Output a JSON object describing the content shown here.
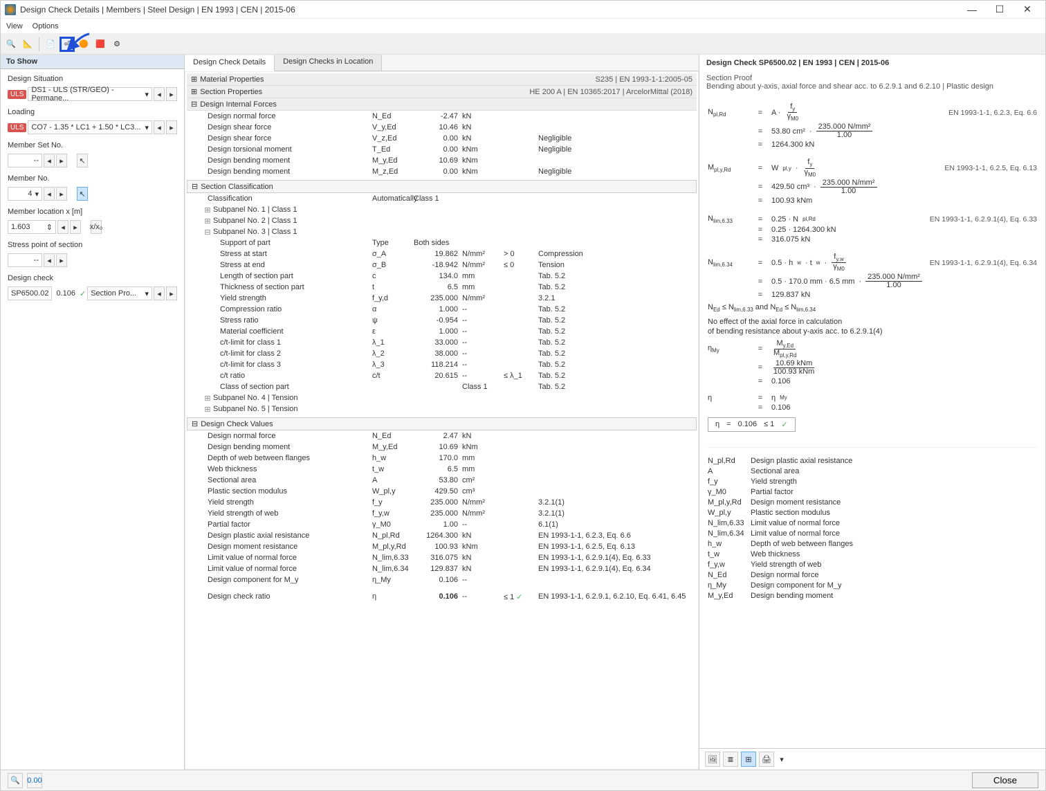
{
  "window": {
    "title": "Design Check Details | Members | Steel Design | EN 1993 | CEN | 2015-06"
  },
  "menu": {
    "view": "View",
    "options": "Options"
  },
  "left": {
    "header": "To Show",
    "ds_label": "Design Situation",
    "ds_value": "DS1 - ULS (STR/GEO) - Permane...",
    "load_label": "Loading",
    "load_value": "CO7 - 1.35 * LC1 + 1.50 * LC3...",
    "memset_label": "Member Set No.",
    "memset_value": "--",
    "memno_label": "Member No.",
    "memno_value": "4",
    "loc_label": "Member location x [m]",
    "loc_value": "1.603",
    "stress_label": "Stress point of section",
    "stress_value": "--",
    "dc_label": "Design check",
    "dc_code": "SP6500.02",
    "dc_ratio": "0.106",
    "dc_name": "Section Pro..."
  },
  "tabs": {
    "t1": "Design Check Details",
    "t2": "Design Checks in Location"
  },
  "mat_props": {
    "label": "Material Properties",
    "right": "S235 | EN 1993-1-1:2005-05"
  },
  "sec_props": {
    "label": "Section Properties",
    "right": "HE 200 A | EN 10365:2017 | ArcelorMittal (2018)"
  },
  "dif": {
    "label": "Design Internal Forces",
    "rows": [
      {
        "lbl": "Design normal force",
        "sym": "N_Ed",
        "val": "-2.47",
        "unit": "kN",
        "ref": ""
      },
      {
        "lbl": "Design shear force",
        "sym": "V_y,Ed",
        "val": "10.46",
        "unit": "kN",
        "ref": ""
      },
      {
        "lbl": "Design shear force",
        "sym": "V_z,Ed",
        "val": "0.00",
        "unit": "kN",
        "ref": "Negligible"
      },
      {
        "lbl": "Design torsional moment",
        "sym": "T_Ed",
        "val": "0.00",
        "unit": "kNm",
        "ref": "Negligible"
      },
      {
        "lbl": "Design bending moment",
        "sym": "M_y,Ed",
        "val": "10.69",
        "unit": "kNm",
        "ref": ""
      },
      {
        "lbl": "Design bending moment",
        "sym": "M_z,Ed",
        "val": "0.00",
        "unit": "kNm",
        "ref": "Negligible"
      }
    ]
  },
  "sc": {
    "label": "Section Classification",
    "class_row": {
      "lbl": "Classification",
      "sym": "Automatically",
      "cls": "Class 1"
    },
    "sp1": "Subpanel No. 1 | Class 1",
    "sp2": "Subpanel No. 2 | Class 1",
    "sp3": "Subpanel No. 3 | Class 1",
    "sp3_head": {
      "lbl": "Support of part",
      "sym": "Type",
      "cls": "Both sides"
    },
    "sp3_rows": [
      {
        "lbl": "Stress at start",
        "sym": "σ_A",
        "val": "19.862",
        "unit": "N/mm²",
        "cmp": "> 0",
        "ref": "Compression"
      },
      {
        "lbl": "Stress at end",
        "sym": "σ_B",
        "val": "-18.942",
        "unit": "N/mm²",
        "cmp": "≤ 0",
        "ref": "Tension"
      },
      {
        "lbl": "Length of section part",
        "sym": "c",
        "val": "134.0",
        "unit": "mm",
        "cmp": "",
        "ref": "Tab. 5.2"
      },
      {
        "lbl": "Thickness of section part",
        "sym": "t",
        "val": "6.5",
        "unit": "mm",
        "cmp": "",
        "ref": "Tab. 5.2"
      },
      {
        "lbl": "Yield strength",
        "sym": "f_y,d",
        "val": "235.000",
        "unit": "N/mm²",
        "cmp": "",
        "ref": "3.2.1"
      },
      {
        "lbl": "Compression ratio",
        "sym": "α",
        "val": "1.000",
        "unit": "--",
        "cmp": "",
        "ref": "Tab. 5.2"
      },
      {
        "lbl": "Stress ratio",
        "sym": "ψ",
        "val": "-0.954",
        "unit": "--",
        "cmp": "",
        "ref": "Tab. 5.2"
      },
      {
        "lbl": "Material coefficient",
        "sym": "ε",
        "val": "1.000",
        "unit": "--",
        "cmp": "",
        "ref": "Tab. 5.2"
      },
      {
        "lbl": "c/t-limit for class 1",
        "sym": "λ_1",
        "val": "33.000",
        "unit": "--",
        "cmp": "",
        "ref": "Tab. 5.2"
      },
      {
        "lbl": "c/t-limit for class 2",
        "sym": "λ_2",
        "val": "38.000",
        "unit": "--",
        "cmp": "",
        "ref": "Tab. 5.2"
      },
      {
        "lbl": "c/t-limit for class 3",
        "sym": "λ_3",
        "val": "118.214",
        "unit": "--",
        "cmp": "",
        "ref": "Tab. 5.2"
      },
      {
        "lbl": "c/t ratio",
        "sym": "c/t",
        "val": "20.615",
        "unit": "--",
        "cmp": "≤ λ_1",
        "ref": "Tab. 5.2"
      },
      {
        "lbl": "Class of section part",
        "sym": "",
        "val": "",
        "unit": "Class 1",
        "cmp": "",
        "ref": "Tab. 5.2"
      }
    ],
    "sp4": "Subpanel No. 4 | Tension",
    "sp5": "Subpanel No. 5 | Tension"
  },
  "dcv": {
    "label": "Design Check Values",
    "rows": [
      {
        "lbl": "Design normal force",
        "sym": "N_Ed",
        "val": "2.47",
        "unit": "kN",
        "ref": ""
      },
      {
        "lbl": "Design bending moment",
        "sym": "M_y,Ed",
        "val": "10.69",
        "unit": "kNm",
        "ref": ""
      },
      {
        "lbl": "Depth of web between flanges",
        "sym": "h_w",
        "val": "170.0",
        "unit": "mm",
        "ref": ""
      },
      {
        "lbl": "Web thickness",
        "sym": "t_w",
        "val": "6.5",
        "unit": "mm",
        "ref": ""
      },
      {
        "lbl": "Sectional area",
        "sym": "A",
        "val": "53.80",
        "unit": "cm²",
        "ref": ""
      },
      {
        "lbl": "Plastic section modulus",
        "sym": "W_pl,y",
        "val": "429.50",
        "unit": "cm³",
        "ref": ""
      },
      {
        "lbl": "Yield strength",
        "sym": "f_y",
        "val": "235.000",
        "unit": "N/mm²",
        "ref": "3.2.1(1)"
      },
      {
        "lbl": "Yield strength of web",
        "sym": "f_y,w",
        "val": "235.000",
        "unit": "N/mm²",
        "ref": "3.2.1(1)"
      },
      {
        "lbl": "Partial factor",
        "sym": "γ_M0",
        "val": "1.00",
        "unit": "--",
        "ref": "6.1(1)"
      },
      {
        "lbl": "Design plastic axial resistance",
        "sym": "N_pl,Rd",
        "val": "1264.300",
        "unit": "kN",
        "ref": "EN 1993-1-1, 6.2.3, Eq. 6.6"
      },
      {
        "lbl": "Design moment resistance",
        "sym": "M_pl,y,Rd",
        "val": "100.93",
        "unit": "kNm",
        "ref": "EN 1993-1-1, 6.2.5, Eq. 6.13"
      },
      {
        "lbl": "Limit value of normal force",
        "sym": "N_lim,6.33",
        "val": "316.075",
        "unit": "kN",
        "ref": "EN 1993-1-1, 6.2.9.1(4), Eq. 6.33"
      },
      {
        "lbl": "Limit value of normal force",
        "sym": "N_lim,6.34",
        "val": "129.837",
        "unit": "kN",
        "ref": "EN 1993-1-1, 6.2.9.1(4), Eq. 6.34"
      },
      {
        "lbl": "Design component for M_y",
        "sym": "η_My",
        "val": "0.106",
        "unit": "--",
        "ref": ""
      }
    ],
    "final": {
      "lbl": "Design check ratio",
      "sym": "η",
      "val": "0.106",
      "unit": "--",
      "cmp": "≤ 1",
      "ref": "EN 1993-1-1, 6.2.9.1, 6.2.10, Eq. 6.41, 6.45"
    }
  },
  "right": {
    "title": "Design Check SP6500.02 | EN 1993 | CEN | 2015-06",
    "subtitle": "Section Proof",
    "desc": "Bending about y-axis, axial force and shear acc. to 6.2.9.1 and 6.2.10 | Plastic design",
    "f1": {
      "sym": "N_pl,Rd",
      "ref": "EN 1993-1-1, 6.2.3, Eq. 6.6",
      "l2": "53.80 cm²",
      "l2n": "235.000 N/mm²",
      "l2d": "1.00",
      "l3": "1264.300 kN"
    },
    "f2": {
      "sym": "M_pl,y,Rd",
      "ref": "EN 1993-1-1, 6.2.5, Eq. 6.13",
      "l2": "429.50 cm³",
      "l2n": "235.000 N/mm²",
      "l2d": "1.00",
      "l3": "100.93 kNm"
    },
    "f3": {
      "sym": "N_lim,6.33",
      "ref": "EN 1993-1-1, 6.2.9.1(4), Eq. 6.33",
      "l2": "0.25 · 1264.300 kN",
      "l3": "316.075 kN"
    },
    "f4": {
      "sym": "N_lim,6.34",
      "ref": "EN 1993-1-1, 6.2.9.1(4), Eq. 6.34",
      "l2a": "0.5 · 170.0 mm · 6.5 mm",
      "l2n": "235.000 N/mm²",
      "l2d": "1.00",
      "l3": "129.837 kN"
    },
    "cond": "N_Ed ≤ N_lim,6.33 and N_Ed ≤ N_lim,6.34",
    "note1": "No effect of the axial force in calculation",
    "note2": "of bending resistance about y-axis acc. to 6.2.9.1(4)",
    "f5": {
      "sym": "η_My",
      "l1n": "M_y,Ed",
      "l1d": "M_pl,y,Rd",
      "l2n": "10.69 kNm",
      "l2d": "100.93 kNm",
      "l3": "0.106"
    },
    "f6": {
      "sym": "η",
      "l1": "η_My",
      "l2": "0.106"
    },
    "result": {
      "sym": "η",
      "val": "0.106",
      "cond": "≤ 1"
    },
    "legend": [
      {
        "s": "N_pl,Rd",
        "d": "Design plastic axial resistance"
      },
      {
        "s": "A",
        "d": "Sectional area"
      },
      {
        "s": "f_y",
        "d": "Yield strength"
      },
      {
        "s": "γ_M0",
        "d": "Partial factor"
      },
      {
        "s": "M_pl,y,Rd",
        "d": "Design moment resistance"
      },
      {
        "s": "W_pl,y",
        "d": "Plastic section modulus"
      },
      {
        "s": "N_lim,6.33",
        "d": "Limit value of normal force"
      },
      {
        "s": "N_lim,6.34",
        "d": "Limit value of normal force"
      },
      {
        "s": "h_w",
        "d": "Depth of web between flanges"
      },
      {
        "s": "t_w",
        "d": "Web thickness"
      },
      {
        "s": "f_y,w",
        "d": "Yield strength of web"
      },
      {
        "s": "N_Ed",
        "d": "Design normal force"
      },
      {
        "s": "η_My",
        "d": "Design component for M_y"
      },
      {
        "s": "M_y,Ed",
        "d": "Design bending moment"
      }
    ]
  },
  "footer": {
    "close": "Close"
  }
}
